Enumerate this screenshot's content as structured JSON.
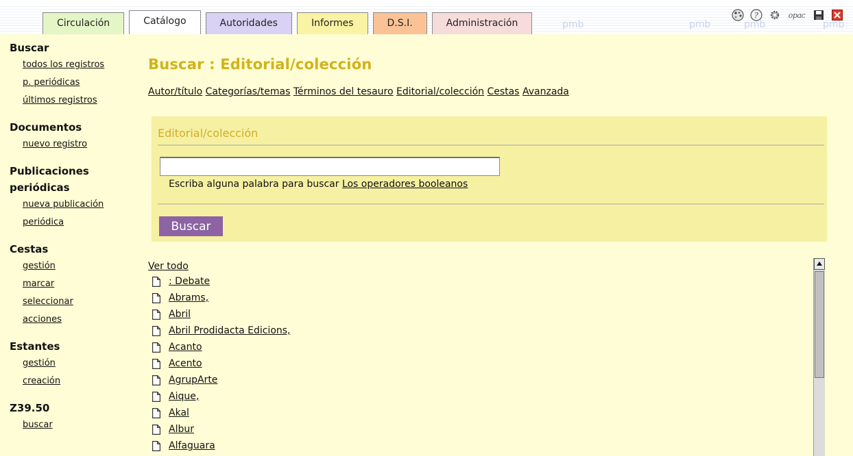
{
  "tabs": [
    {
      "label": "Circulación"
    },
    {
      "label": "Catálogo"
    },
    {
      "label": "Autoridades"
    },
    {
      "label": "Informes"
    },
    {
      "label": "D.S.I."
    },
    {
      "label": "Administración"
    }
  ],
  "active_tab": "Catálogo",
  "watermark": "pmb",
  "toolbar": {
    "icons": [
      "palette-icon",
      "help-icon",
      "settings-icon",
      "opac-icon",
      "save-icon",
      "close-icon"
    ],
    "opac_label": "opac"
  },
  "menu": {
    "buscar": {
      "title": "Buscar",
      "items": [
        "todos los registros",
        "p. periódicas",
        "últimos registros"
      ]
    },
    "documentos": {
      "title": "Documentos",
      "items": [
        "nuevo registro"
      ]
    },
    "publicaciones": {
      "title_line1": "Publicaciones",
      "title_line2": "periódicas",
      "items": [
        "nueva publicación",
        "periódica"
      ]
    },
    "cestas": {
      "title": "Cestas",
      "items": [
        "gestión",
        "marcar",
        "seleccionar",
        "acciones"
      ]
    },
    "estantes": {
      "title": "Estantes",
      "items": [
        "gestión",
        "creación"
      ]
    },
    "z3950": {
      "title": "Z39.50",
      "items": [
        "buscar"
      ]
    }
  },
  "main": {
    "title": "Buscar : Editorial/colección",
    "search_types": [
      "Autor/título",
      "Categorías/temas",
      "Términos del tesauro",
      "Editorial/colección",
      "Cestas",
      "Avanzada"
    ]
  },
  "search_panel": {
    "title": "Editorial/colección",
    "input_value": "",
    "hint": "Escriba alguna palabra para buscar",
    "hint_link": "Los operadores booleanos",
    "button": "Buscar"
  },
  "results": {
    "ver_todo": "Ver todo",
    "items": [
      ": Debate",
      "Abrams,",
      "Abril",
      "Abril Prodidacta Edicions,",
      "Acanto",
      "Acento",
      "AgrupArte",
      "Aique,",
      "Akal",
      "Albur",
      "Alfaguara"
    ]
  },
  "colors": {
    "background": "#fefdd6",
    "title": "#d2b21a",
    "panel": "#f6f0a2",
    "button": "#8d63a3"
  }
}
